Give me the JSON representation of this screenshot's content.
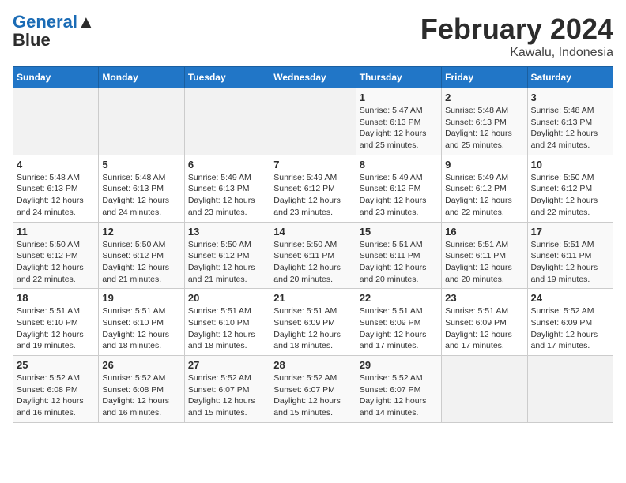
{
  "header": {
    "logo_line1": "General",
    "logo_line2": "Blue",
    "month_title": "February 2024",
    "location": "Kawalu, Indonesia"
  },
  "weekdays": [
    "Sunday",
    "Monday",
    "Tuesday",
    "Wednesday",
    "Thursday",
    "Friday",
    "Saturday"
  ],
  "weeks": [
    [
      {
        "day": "",
        "info": ""
      },
      {
        "day": "",
        "info": ""
      },
      {
        "day": "",
        "info": ""
      },
      {
        "day": "",
        "info": ""
      },
      {
        "day": "1",
        "info": "Sunrise: 5:47 AM\nSunset: 6:13 PM\nDaylight: 12 hours\nand 25 minutes."
      },
      {
        "day": "2",
        "info": "Sunrise: 5:48 AM\nSunset: 6:13 PM\nDaylight: 12 hours\nand 25 minutes."
      },
      {
        "day": "3",
        "info": "Sunrise: 5:48 AM\nSunset: 6:13 PM\nDaylight: 12 hours\nand 24 minutes."
      }
    ],
    [
      {
        "day": "4",
        "info": "Sunrise: 5:48 AM\nSunset: 6:13 PM\nDaylight: 12 hours\nand 24 minutes."
      },
      {
        "day": "5",
        "info": "Sunrise: 5:48 AM\nSunset: 6:13 PM\nDaylight: 12 hours\nand 24 minutes."
      },
      {
        "day": "6",
        "info": "Sunrise: 5:49 AM\nSunset: 6:13 PM\nDaylight: 12 hours\nand 23 minutes."
      },
      {
        "day": "7",
        "info": "Sunrise: 5:49 AM\nSunset: 6:12 PM\nDaylight: 12 hours\nand 23 minutes."
      },
      {
        "day": "8",
        "info": "Sunrise: 5:49 AM\nSunset: 6:12 PM\nDaylight: 12 hours\nand 23 minutes."
      },
      {
        "day": "9",
        "info": "Sunrise: 5:49 AM\nSunset: 6:12 PM\nDaylight: 12 hours\nand 22 minutes."
      },
      {
        "day": "10",
        "info": "Sunrise: 5:50 AM\nSunset: 6:12 PM\nDaylight: 12 hours\nand 22 minutes."
      }
    ],
    [
      {
        "day": "11",
        "info": "Sunrise: 5:50 AM\nSunset: 6:12 PM\nDaylight: 12 hours\nand 22 minutes."
      },
      {
        "day": "12",
        "info": "Sunrise: 5:50 AM\nSunset: 6:12 PM\nDaylight: 12 hours\nand 21 minutes."
      },
      {
        "day": "13",
        "info": "Sunrise: 5:50 AM\nSunset: 6:12 PM\nDaylight: 12 hours\nand 21 minutes."
      },
      {
        "day": "14",
        "info": "Sunrise: 5:50 AM\nSunset: 6:11 PM\nDaylight: 12 hours\nand 20 minutes."
      },
      {
        "day": "15",
        "info": "Sunrise: 5:51 AM\nSunset: 6:11 PM\nDaylight: 12 hours\nand 20 minutes."
      },
      {
        "day": "16",
        "info": "Sunrise: 5:51 AM\nSunset: 6:11 PM\nDaylight: 12 hours\nand 20 minutes."
      },
      {
        "day": "17",
        "info": "Sunrise: 5:51 AM\nSunset: 6:11 PM\nDaylight: 12 hours\nand 19 minutes."
      }
    ],
    [
      {
        "day": "18",
        "info": "Sunrise: 5:51 AM\nSunset: 6:10 PM\nDaylight: 12 hours\nand 19 minutes."
      },
      {
        "day": "19",
        "info": "Sunrise: 5:51 AM\nSunset: 6:10 PM\nDaylight: 12 hours\nand 18 minutes."
      },
      {
        "day": "20",
        "info": "Sunrise: 5:51 AM\nSunset: 6:10 PM\nDaylight: 12 hours\nand 18 minutes."
      },
      {
        "day": "21",
        "info": "Sunrise: 5:51 AM\nSunset: 6:09 PM\nDaylight: 12 hours\nand 18 minutes."
      },
      {
        "day": "22",
        "info": "Sunrise: 5:51 AM\nSunset: 6:09 PM\nDaylight: 12 hours\nand 17 minutes."
      },
      {
        "day": "23",
        "info": "Sunrise: 5:51 AM\nSunset: 6:09 PM\nDaylight: 12 hours\nand 17 minutes."
      },
      {
        "day": "24",
        "info": "Sunrise: 5:52 AM\nSunset: 6:09 PM\nDaylight: 12 hours\nand 17 minutes."
      }
    ],
    [
      {
        "day": "25",
        "info": "Sunrise: 5:52 AM\nSunset: 6:08 PM\nDaylight: 12 hours\nand 16 minutes."
      },
      {
        "day": "26",
        "info": "Sunrise: 5:52 AM\nSunset: 6:08 PM\nDaylight: 12 hours\nand 16 minutes."
      },
      {
        "day": "27",
        "info": "Sunrise: 5:52 AM\nSunset: 6:07 PM\nDaylight: 12 hours\nand 15 minutes."
      },
      {
        "day": "28",
        "info": "Sunrise: 5:52 AM\nSunset: 6:07 PM\nDaylight: 12 hours\nand 15 minutes."
      },
      {
        "day": "29",
        "info": "Sunrise: 5:52 AM\nSunset: 6:07 PM\nDaylight: 12 hours\nand 14 minutes."
      },
      {
        "day": "",
        "info": ""
      },
      {
        "day": "",
        "info": ""
      }
    ]
  ]
}
